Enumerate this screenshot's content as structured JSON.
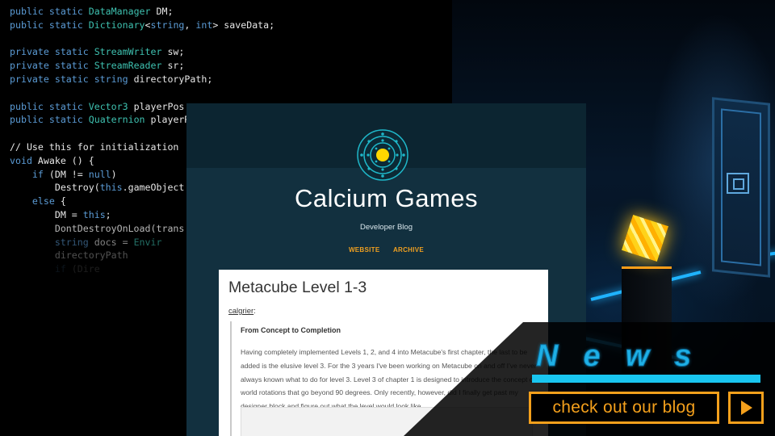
{
  "code_editor": {
    "lines": [
      [
        {
          "t": "kw",
          "s": "public static "
        },
        {
          "t": "ty",
          "s": "DataManager"
        },
        {
          "t": "",
          "s": " DM;"
        }
      ],
      [
        {
          "t": "kw",
          "s": "public static "
        },
        {
          "t": "ty",
          "s": "Dictionary"
        },
        {
          "t": "",
          "s": "<"
        },
        {
          "t": "kw",
          "s": "string"
        },
        {
          "t": "",
          "s": ", "
        },
        {
          "t": "kw",
          "s": "int"
        },
        {
          "t": "",
          "s": "> saveData;"
        }
      ],
      [],
      [
        {
          "t": "kw",
          "s": "private static "
        },
        {
          "t": "ty",
          "s": "StreamWriter"
        },
        {
          "t": "",
          "s": " sw;"
        }
      ],
      [
        {
          "t": "kw",
          "s": "private static "
        },
        {
          "t": "ty",
          "s": "StreamReader"
        },
        {
          "t": "",
          "s": " sr;"
        }
      ],
      [
        {
          "t": "kw",
          "s": "private static string"
        },
        {
          "t": "",
          "s": " directoryPath;"
        }
      ],
      [],
      [
        {
          "t": "kw",
          "s": "public static "
        },
        {
          "t": "ty",
          "s": "Vector3"
        },
        {
          "t": "",
          "s": " playerPos"
        }
      ],
      [
        {
          "t": "kw",
          "s": "public static "
        },
        {
          "t": "ty",
          "s": "Quaternion"
        },
        {
          "t": "",
          "s": " playerR"
        }
      ],
      [],
      [
        {
          "t": "cm",
          "s": "// Use this for initialization"
        }
      ],
      [
        {
          "t": "kw",
          "s": "void"
        },
        {
          "t": "",
          "s": " Awake () {"
        }
      ],
      [
        {
          "t": "",
          "s": "    "
        },
        {
          "t": "kw",
          "s": "if"
        },
        {
          "t": "",
          "s": " (DM != "
        },
        {
          "t": "kw",
          "s": "null"
        },
        {
          "t": "",
          "s": ")"
        }
      ],
      [
        {
          "t": "",
          "s": "        Destroy("
        },
        {
          "t": "kw",
          "s": "this"
        },
        {
          "t": "",
          "s": ".gameObject"
        }
      ],
      [
        {
          "t": "",
          "s": "    "
        },
        {
          "t": "kw",
          "s": "else"
        },
        {
          "t": "",
          "s": " {"
        }
      ],
      [
        {
          "t": "",
          "s": "        DM = "
        },
        {
          "t": "kw",
          "s": "this"
        },
        {
          "t": "",
          "s": ";"
        }
      ],
      [
        {
          "t": "",
          "s": "        DontDestroyOnLoad(trans"
        }
      ],
      [
        {
          "t": "",
          "s": "        "
        },
        {
          "t": "kw",
          "s": "string"
        },
        {
          "t": "",
          "s": " docs = "
        },
        {
          "t": "ty",
          "s": "Envir"
        }
      ],
      [
        {
          "t": "",
          "s": "        directoryPath"
        }
      ],
      [
        {
          "t": "",
          "s": "        "
        },
        {
          "t": "kw",
          "s": "if"
        },
        {
          "t": "",
          "s": " (Dire"
        }
      ]
    ]
  },
  "blog": {
    "site_title": "Calcium Games",
    "tagline": "Developer Blog",
    "nav": [
      "WEBSITE",
      "ARCHIVE"
    ],
    "post": {
      "title": "Metacube Level 1-3",
      "author": "calgrier",
      "author_suffix": ":",
      "subheading": "From Concept to Completion",
      "body": "Having completely implemented Levels 1, 2, and 4 into Metacube's first chapter, the last to be added is the elusive level 3. For the 3 years I've been working on Metacube on and off I've never always known what to do for level 3. Level 3 of chapter 1 is designed to introduce the concept of world rotations that go beyond 90 degrees. Only recently, however, did I finally get past my designer block and figure out what the level would look like."
    }
  },
  "news_overlay": {
    "title": "News",
    "cta_label": "check out our blog",
    "play_icon": "play-triangle-icon"
  },
  "colors": {
    "accent_orange": "#f4a01c",
    "news_blue": "#1eb0e6",
    "blog_bg": "#12303f"
  }
}
